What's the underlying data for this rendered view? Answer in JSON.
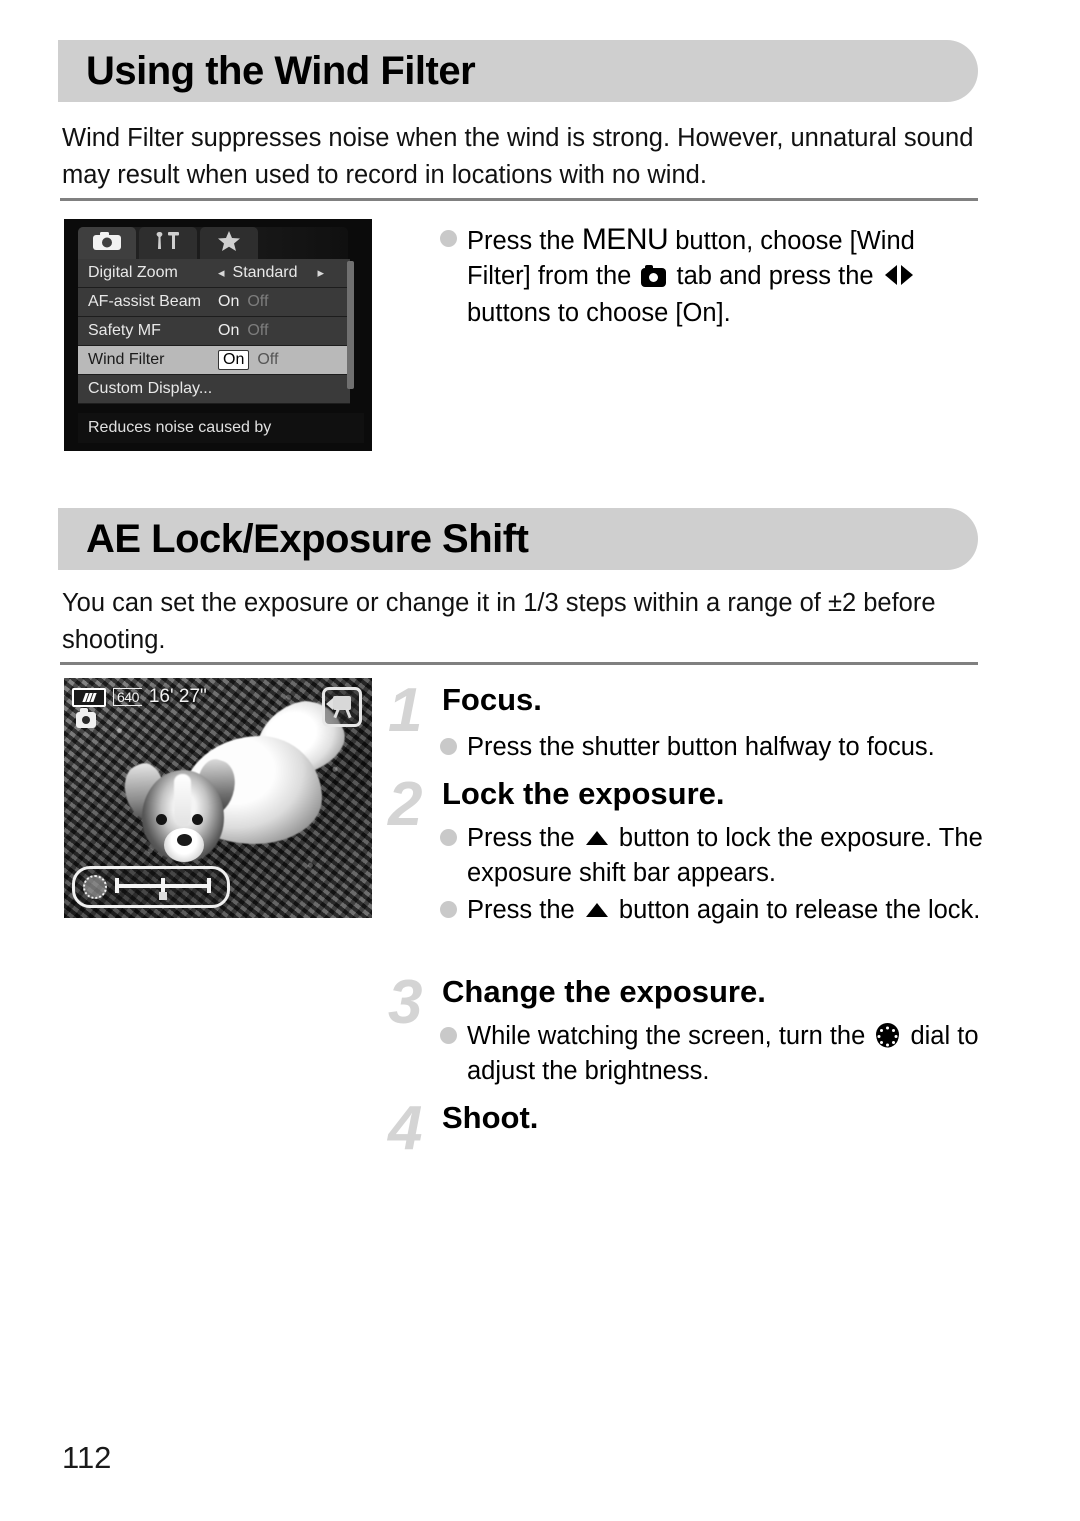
{
  "page": {
    "number": "112"
  },
  "section1": {
    "heading": "Using the Wind Filter",
    "intro": "Wind Filter suppresses noise when the wind is strong. However, unnatural sound may result when used to record in locations with no wind.",
    "instruction": {
      "part1": "Press the ",
      "menu_word": "MENU",
      "part2": " button, choose [Wind Filter] from the ",
      "camera_icon": "camera-tab-icon",
      "part3": " tab and press the ",
      "lr_icon": "left-right-buttons-icon",
      "part4": " buttons to choose [On]."
    },
    "camera_menu": {
      "tabs": [
        {
          "name": "shooting-tab",
          "icon": "camera-icon",
          "active": true
        },
        {
          "name": "settings-tab",
          "icon": "wrench-hammer-icon",
          "active": false
        },
        {
          "name": "my-menu-tab",
          "icon": "star-icon",
          "active": false
        }
      ],
      "rows": [
        {
          "label": "Digital Zoom",
          "value": "Standard",
          "type": "spinner",
          "selected": false
        },
        {
          "label": "AF-assist Beam",
          "on": "On",
          "off": "Off",
          "type": "toggle",
          "chosen": "On",
          "selected": false
        },
        {
          "label": "Safety MF",
          "on": "On",
          "off": "Off",
          "type": "toggle",
          "chosen": "On",
          "selected": false
        },
        {
          "label": "Wind Filter",
          "on": "On",
          "off": "Off",
          "type": "toggle",
          "chosen": "On",
          "selected": true
        },
        {
          "label": "Custom Display...",
          "value": "",
          "type": "submenu",
          "selected": false
        }
      ],
      "help_text": "Reduces noise caused by"
    }
  },
  "section2": {
    "heading": "AE Lock/Exposure Shift",
    "intro": "You can set the exposure or change it in 1/3 steps within a range of ±2 before shooting.",
    "steps": [
      {
        "number": "1",
        "title": "Focus.",
        "bullets": [
          {
            "text": "Press the shutter button halfway to focus."
          }
        ]
      },
      {
        "number": "2",
        "title": "Lock the exposure.",
        "bullets": [
          {
            "pre": "Press the ",
            "icon": "up-button-icon",
            "post": " button to lock the exposure. The exposure shift bar appears."
          },
          {
            "pre": "Press the ",
            "icon": "up-button-icon",
            "post": " button again to release the lock."
          }
        ]
      },
      {
        "number": "3",
        "title": "Change the exposure.",
        "bullets": [
          {
            "pre": "While watching the screen, turn the ",
            "icon": "control-dial-icon",
            "post": " dial to adjust the brightness."
          }
        ]
      },
      {
        "number": "4",
        "title": "Shoot.",
        "bullets": []
      }
    ],
    "photo_screen": {
      "battery": "battery-icon",
      "resolution": "640",
      "remaining_time": "16' 27\"",
      "mode_icon": "still-image-mode-icon",
      "movie_icon": "movie-mode-icon",
      "exposure_bar": "exposure-shift-bar"
    }
  },
  "colors": {
    "heading_bg": "#cfcfcf",
    "rule": "#808080",
    "bullet": "#c9c9c9",
    "step_number": "#d4d4d4",
    "text": "#000000"
  }
}
